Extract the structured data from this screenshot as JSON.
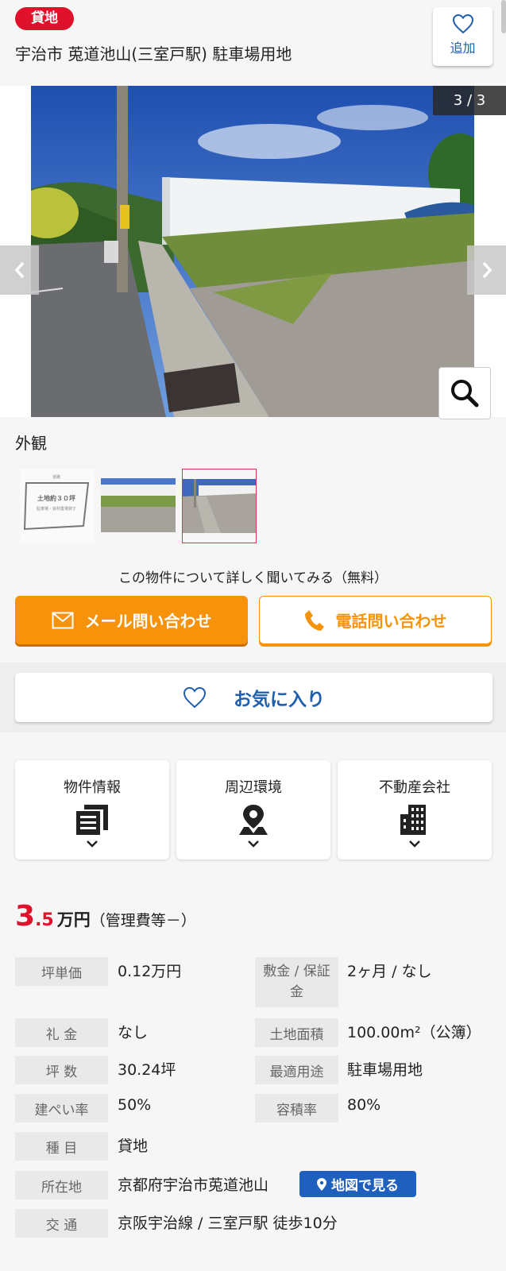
{
  "header": {
    "badge": "貸地",
    "title": "宇治市 莵道池山(三室戸駅) 駐車場用地",
    "add_label": "追加"
  },
  "gallery": {
    "counter": "3 / 3",
    "caption": "外観",
    "thumb1_text": "土地約３０坪",
    "thumb1_sub": "駐車場・資材置場貸す",
    "thumb1_top": "道路"
  },
  "inquiry": {
    "prompt": "この物件について詳しく聞いてみる（無料）",
    "mail_label": "メール問い合わせ",
    "tel_label": "電話問い合わせ",
    "favorite_label": "お気に入り"
  },
  "tabs": [
    {
      "label": "物件情報",
      "icon": "document-icon"
    },
    {
      "label": "周辺環境",
      "icon": "map-pin-icon"
    },
    {
      "label": "不動産会社",
      "icon": "building-icon"
    }
  ],
  "price": {
    "main_int": "3",
    "main_dec": ".5",
    "unit": "万円",
    "management": "（管理費等－）"
  },
  "details": {
    "tsubo_price_label": "坪単価",
    "tsubo_price": "0.12万円",
    "deposit_label": "敷金 / 保証金",
    "deposit": "2ヶ月 / なし",
    "key_money_label": "礼 金",
    "key_money": "なし",
    "land_area_label": "土地面積",
    "land_area": "100.00m²（公簿）",
    "tsubo_label": "坪 数",
    "tsubo": "30.24坪",
    "best_use_label": "最適用途",
    "best_use": "駐車場用地",
    "coverage_label": "建ぺい率",
    "coverage": "50%",
    "floor_ratio_label": "容積率",
    "floor_ratio": "80%",
    "category_label": "種 目",
    "category": "貸地",
    "address_label": "所在地",
    "address": "京都府宇治市莵道池山",
    "map_button": "地図で見る",
    "transport_label": "交 通",
    "transport": "京阪宇治線 / 三室戸駅 徒歩10分"
  },
  "colors": {
    "accent_red": "#e0112a",
    "accent_orange": "#f7930a",
    "link_blue": "#1f5fae"
  }
}
